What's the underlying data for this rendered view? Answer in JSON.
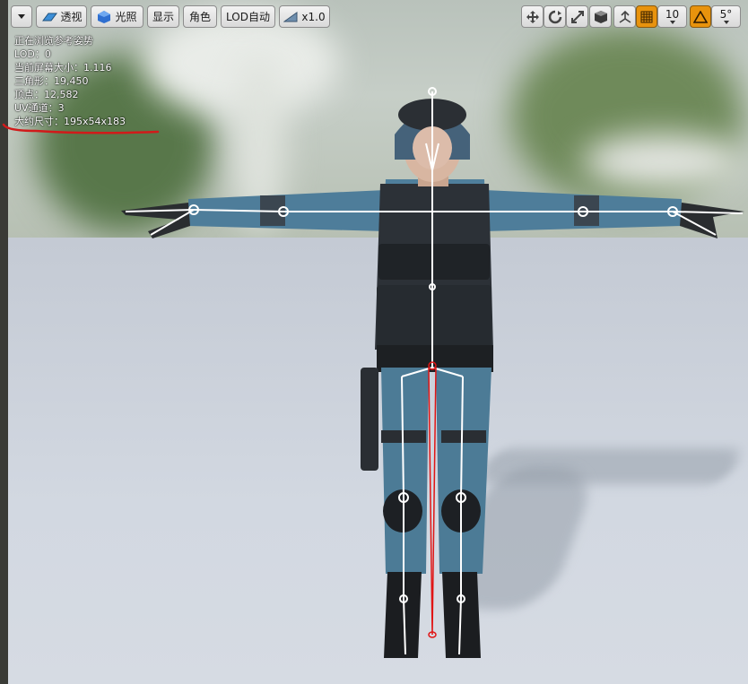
{
  "toolbar": {
    "menu_icon": "chevron-down-icon",
    "perspective_label": "透视",
    "lighting_label": "光照",
    "show_label": "显示",
    "character_label": "角色",
    "lod_label": "LOD自动",
    "speed_label": "x1.0",
    "grid_size": "10",
    "rotation_snap": "5°",
    "accent_color": "#e8930d"
  },
  "stats": {
    "line1": "正在浏览参考姿势",
    "line2": "LOD：0",
    "line3": "当前屏幕大小：1.116",
    "line4": "三角形：19,450",
    "line5": "顶点：12,582",
    "line6": "UV通道：3",
    "line7": "大约尺寸：195x54x183"
  },
  "annotation_color": "#d11a1a"
}
